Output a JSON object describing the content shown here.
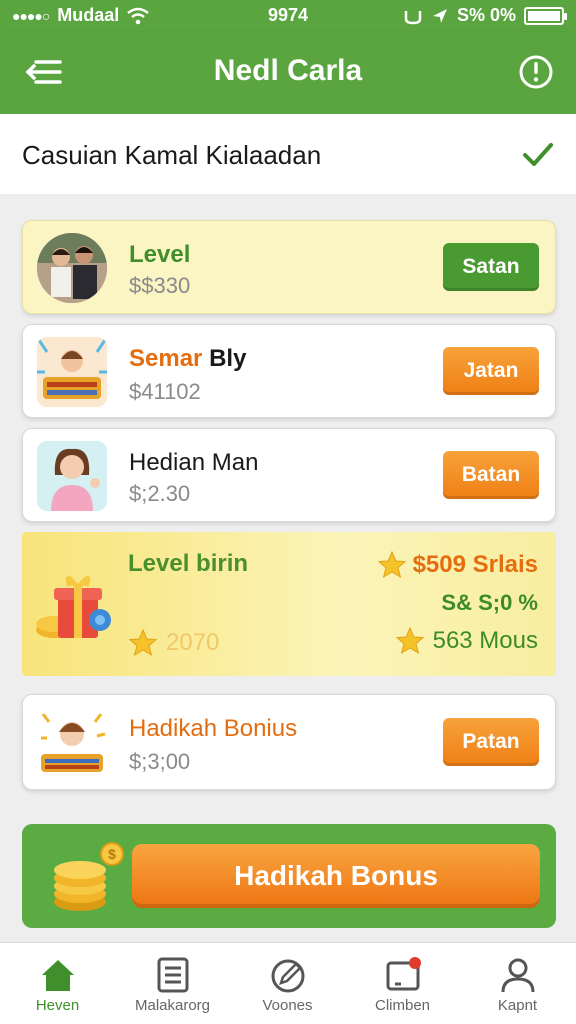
{
  "status_bar": {
    "carrier": "Mudaal",
    "time": "9974",
    "battery_text": "S% 0%"
  },
  "app_bar": {
    "title": "Nedl Carla",
    "menu_icon": "menu-icon",
    "info_icon": "info-icon"
  },
  "subheader": {
    "label": "Casuian Kamal Kialaadan",
    "check_icon": "checkmark-icon"
  },
  "offers": [
    {
      "name": "Level",
      "price": "$$330",
      "button": "Satan",
      "name_color": "#3f8f2c",
      "button_color": "green"
    },
    {
      "name_a": "Semar",
      "name_b": "Bly",
      "price": "$41102",
      "button": "Jatan"
    },
    {
      "name": "Hedian Man",
      "price": "$;2.30",
      "button": "Batan"
    }
  ],
  "promo": {
    "title": "Level birin",
    "prize1": "$509 Srlais",
    "prize2": "S& S;0 %",
    "prize3": "563 Mous",
    "points": "2070"
  },
  "bonus_card": {
    "name": "Hadikah Bonius",
    "price": "$;3;00",
    "button": "Patan"
  },
  "banner": {
    "button": "Hadikah Bonus"
  },
  "tabs": [
    {
      "label": "Heven",
      "icon": "home-icon",
      "active": true
    },
    {
      "label": "Malakarorg",
      "icon": "list-icon"
    },
    {
      "label": "Voones",
      "icon": "edit-icon"
    },
    {
      "label": "Climben",
      "icon": "tablet-icon"
    },
    {
      "label": "Kapnt",
      "icon": "profile-icon"
    }
  ],
  "colors": {
    "primary_green": "#5aa540",
    "accent_orange": "#ef7f15",
    "highlight_yellow": "#fbf5c4"
  }
}
